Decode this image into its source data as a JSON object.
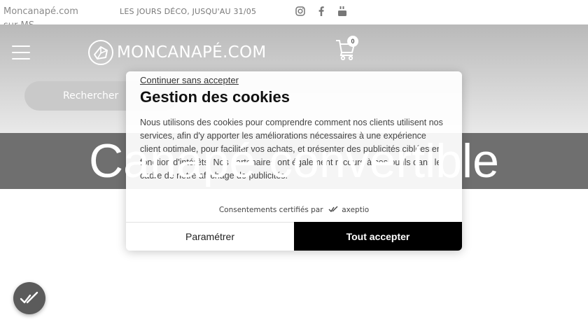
{
  "topbar": {
    "site_name": "Moncanapé.com sur MS",
    "promo": "LES JOURS DÉCO, JUSQU'AU 31/05",
    "social": [
      "instagram-icon",
      "facebook-icon",
      "youtube-icon"
    ]
  },
  "header": {
    "logo_text": "MONCANAPÉ.COM",
    "cart_count": "0",
    "search_label": "Rechercher"
  },
  "hero": {
    "title": "Canapé convertible"
  },
  "cookie_modal": {
    "continue_label": "Continuer sans accepter",
    "title": "Gestion des cookies",
    "body": "Nous utilisons des cookies pour comprendre comment nos clients utilisent nos services, afin d'y apporter les améliorations nécessaires à une expérience client optimale, pour faciliter vos achats, et présenter des publicités ciblées en fonction d'intérêts. Nos partenaires ont également recours à ces outils dans le cadre de notre affichage de publicités.",
    "certified_label": "Consentements certifiés par",
    "brand": "axeptio",
    "settings_label": "Paramétrer",
    "accept_label": "Tout accepter"
  },
  "colors": {
    "accent": "#000000",
    "header_gray": "#c4c4c4",
    "band": "#6f6f6f"
  }
}
